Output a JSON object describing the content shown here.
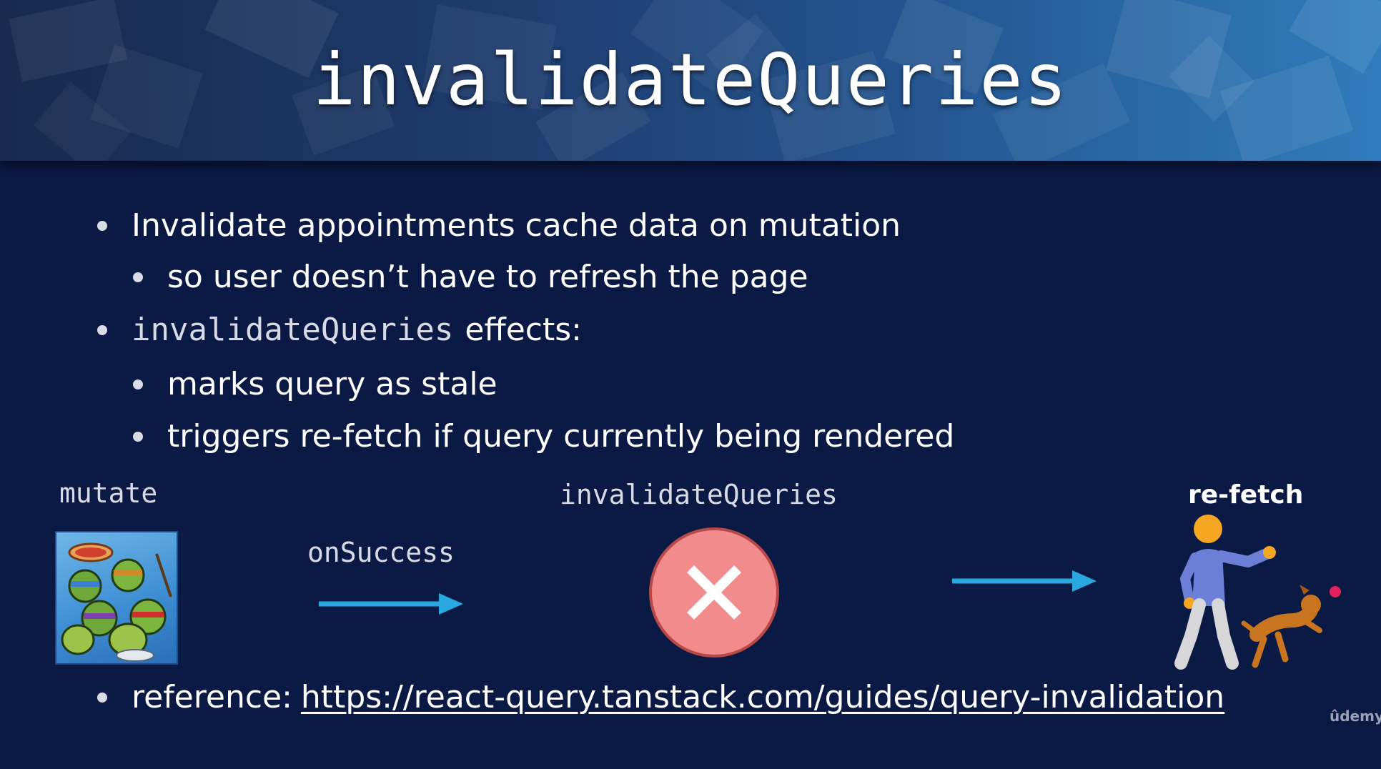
{
  "slide": {
    "title": "invalidateQueries",
    "bullets": {
      "b1": "Invalidate appointments cache data on mutation",
      "b2": "so user doesn’t have to refresh the page",
      "b3_code": "invalidateQueries",
      "b3_text": "effects:",
      "b4": "marks query as stale",
      "b5": "triggers re-fetch if query currently being rendered",
      "b6_label": "reference:",
      "b6_link": "https://react-query.tanstack.com/guides/query-invalidation"
    },
    "diagram": {
      "mutate_label": "mutate",
      "onsuccess_label": "onSuccess",
      "invalidate_label": "invalidateQueries",
      "refetch_label": "re-fetch"
    },
    "watermark": "ûdemy"
  },
  "icons": {
    "turtles": "ninja-turtles-image",
    "arrow": "arrow-right-icon",
    "invalidate": "x-circle-icon",
    "refetch": "person-playing-fetch-with-dog-icon"
  },
  "colors": {
    "background": "#0b1945",
    "arrow": "#29a8e0",
    "x_circle": "#f28b8b",
    "x_circle_border": "#b94848"
  }
}
